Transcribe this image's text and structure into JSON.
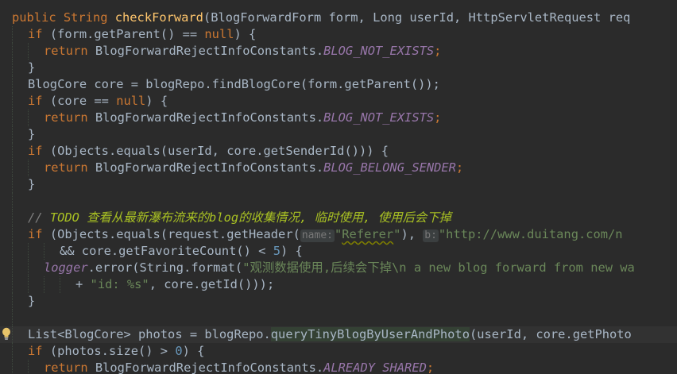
{
  "editor": {
    "lines": {
      "l1": {
        "t1": "public ",
        "t2": "String ",
        "t3": "checkForward",
        "t4": "(BlogForwardForm form, Long userId, HttpServletRequest req"
      },
      "l2": {
        "t1": "if ",
        "t2": "(form.getParent() == ",
        "t3": "null",
        "t4": ") {"
      },
      "l3": {
        "t1": "return ",
        "t2": "BlogForwardRejectInfoConstants.",
        "t3": "BLOG_NOT_EXISTS",
        "t4": ";"
      },
      "l4": {
        "t1": "}"
      },
      "l5": {
        "t1": "BlogCore core = blogRepo.findBlogCore(form.getParent());"
      },
      "l6": {
        "t1": "if ",
        "t2": "(core == ",
        "t3": "null",
        "t4": ") {"
      },
      "l7": {
        "t1": "return ",
        "t2": "BlogForwardRejectInfoConstants.",
        "t3": "BLOG_NOT_EXISTS",
        "t4": ";"
      },
      "l8": {
        "t1": "}"
      },
      "l9": {
        "t1": "if ",
        "t2": "(Objects.equals(userId, core.getSenderId())) {"
      },
      "l10": {
        "t1": "return ",
        "t2": "BlogForwardRejectInfoConstants.",
        "t3": "BLOG_BELONG_SENDER",
        "t4": ";"
      },
      "l11": {
        "t1": "}"
      },
      "l12": {},
      "l13": {
        "t1": "// ",
        "t2": "TODO 查看从最新瀑布流来的blog的收集情况, 临时使用, 使用后会下掉"
      },
      "l14": {
        "t1": "if ",
        "t2": "(Objects.equals(request.getHeader(",
        "t3": "name:",
        "t4": "\"",
        "t5": "Referer",
        "t6": "\"",
        "t7": "), ",
        "t8": "b:",
        "t9": "\"http://www.duitang.com/n"
      },
      "l15": {
        "t1": "&& core.getFavoriteCount() < ",
        "t2": "5",
        "t3": ") {"
      },
      "l16": {
        "t1": "logger",
        "t2": ".error(String.format(",
        "t3": "\"观测数据使用,后续会下掉\\n a new blog forward from new wa"
      },
      "l17": {
        "t1": "+ ",
        "t2": "\"id: %s\"",
        "t3": ", core.getId()));"
      },
      "l18": {
        "t1": "}"
      },
      "l19": {},
      "l20": {
        "t1": "List<BlogCore> photos = blogRepo.",
        "t2": "queryTinyBlogByUserAndPhoto",
        "t3": "(userId, core.getPhoto"
      },
      "l21": {
        "t1": "if ",
        "t2": "(photos.size() > ",
        "t3": "0",
        "t4": ") {"
      },
      "l22": {
        "t1": "return ",
        "t2": "BlogForwardRejectInfoConstants.",
        "t3": "ALREADY_SHARED",
        "t4": ";"
      }
    }
  },
  "colors": {
    "background": "#2b2b2b",
    "keyword": "#cc7832",
    "method_declaration": "#ffc66d",
    "string": "#6a8759",
    "number": "#6897bb",
    "constant": "#9876aa",
    "comment": "#808080",
    "todo": "#a8c023",
    "default_text": "#a9b7c6"
  },
  "icons": {
    "gutter": "intention-bulb-icon"
  }
}
